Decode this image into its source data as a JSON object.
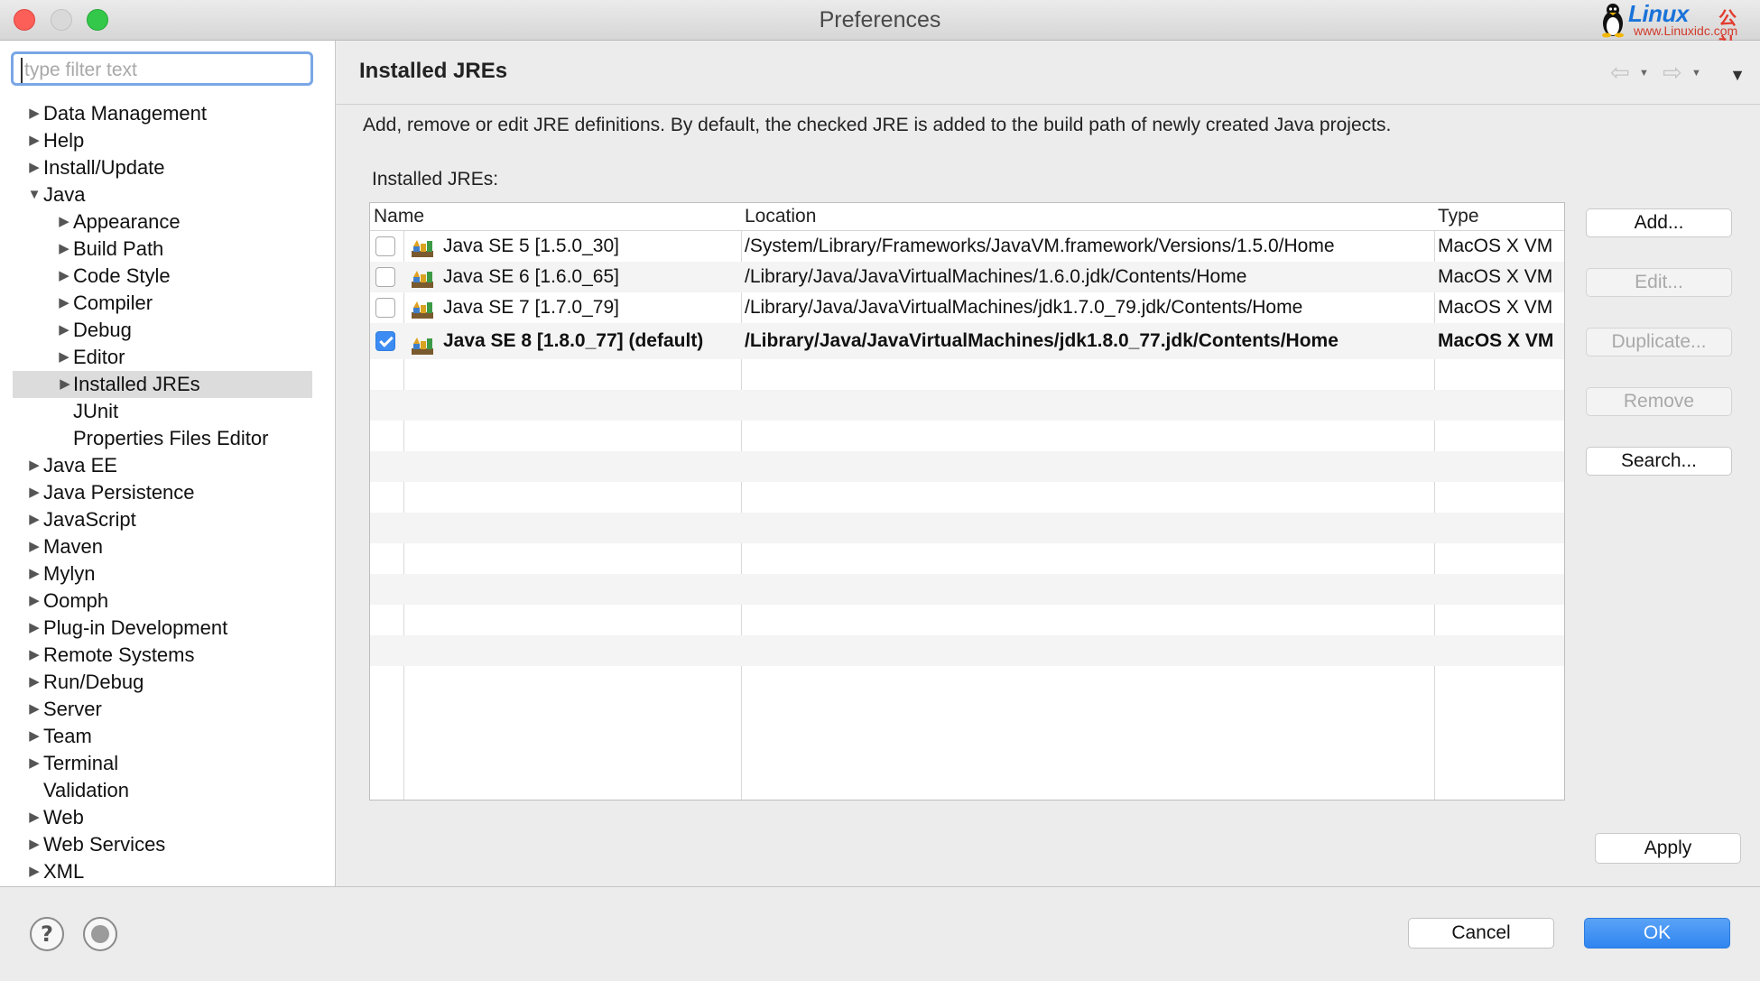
{
  "window": {
    "title": "Preferences",
    "watermark": {
      "brand": "Linux",
      "brand_cn": "公社",
      "url": "www.Linuxidc.com"
    }
  },
  "sidebar": {
    "filter_placeholder": "type filter text",
    "filter_value": "",
    "items": [
      {
        "label": "Data Management",
        "level": 0,
        "arrow": "right"
      },
      {
        "label": "Help",
        "level": 0,
        "arrow": "right"
      },
      {
        "label": "Install/Update",
        "level": 0,
        "arrow": "right"
      },
      {
        "label": "Java",
        "level": 0,
        "arrow": "down"
      },
      {
        "label": "Appearance",
        "level": 1,
        "arrow": "right"
      },
      {
        "label": "Build Path",
        "level": 1,
        "arrow": "right"
      },
      {
        "label": "Code Style",
        "level": 1,
        "arrow": "right"
      },
      {
        "label": "Compiler",
        "level": 1,
        "arrow": "right"
      },
      {
        "label": "Debug",
        "level": 1,
        "arrow": "right"
      },
      {
        "label": "Editor",
        "level": 1,
        "arrow": "right"
      },
      {
        "label": "Installed JREs",
        "level": 1,
        "arrow": "right",
        "selected": true
      },
      {
        "label": "JUnit",
        "level": 1,
        "arrow": "none"
      },
      {
        "label": "Properties Files Editor",
        "level": 1,
        "arrow": "none"
      },
      {
        "label": "Java EE",
        "level": 0,
        "arrow": "right"
      },
      {
        "label": "Java Persistence",
        "level": 0,
        "arrow": "right"
      },
      {
        "label": "JavaScript",
        "level": 0,
        "arrow": "right"
      },
      {
        "label": "Maven",
        "level": 0,
        "arrow": "right"
      },
      {
        "label": "Mylyn",
        "level": 0,
        "arrow": "right"
      },
      {
        "label": "Oomph",
        "level": 0,
        "arrow": "right"
      },
      {
        "label": "Plug-in Development",
        "level": 0,
        "arrow": "right"
      },
      {
        "label": "Remote Systems",
        "level": 0,
        "arrow": "right"
      },
      {
        "label": "Run/Debug",
        "level": 0,
        "arrow": "right"
      },
      {
        "label": "Server",
        "level": 0,
        "arrow": "right"
      },
      {
        "label": "Team",
        "level": 0,
        "arrow": "right"
      },
      {
        "label": "Terminal",
        "level": 0,
        "arrow": "right"
      },
      {
        "label": "Validation",
        "level": 0,
        "arrow": "none"
      },
      {
        "label": "Web",
        "level": 0,
        "arrow": "right"
      },
      {
        "label": "Web Services",
        "level": 0,
        "arrow": "right"
      },
      {
        "label": "XML",
        "level": 0,
        "arrow": "right"
      }
    ]
  },
  "main": {
    "title": "Installed JREs",
    "description": "Add, remove or edit JRE definitions. By default, the checked JRE is added to the build path of newly created Java projects.",
    "section_label": "Installed JREs:",
    "table": {
      "columns": [
        "Name",
        "Location",
        "Type"
      ],
      "rows": [
        {
          "checked": false,
          "bold": false,
          "name": "Java SE 5 [1.5.0_30]",
          "location": "/System/Library/Frameworks/JavaVM.framework/Versions/1.5.0/Home",
          "type": "MacOS X VM"
        },
        {
          "checked": false,
          "bold": false,
          "name": "Java SE 6 [1.6.0_65]",
          "location": "/Library/Java/JavaVirtualMachines/1.6.0.jdk/Contents/Home",
          "type": "MacOS X VM"
        },
        {
          "checked": false,
          "bold": false,
          "name": "Java SE 7 [1.7.0_79]",
          "location": "/Library/Java/JavaVirtualMachines/jdk1.7.0_79.jdk/Contents/Home",
          "type": "MacOS X VM"
        },
        {
          "checked": true,
          "bold": true,
          "name": "Java SE 8 [1.8.0_77] (default)",
          "location": "/Library/Java/JavaVirtualMachines/jdk1.8.0_77.jdk/Contents/Home",
          "type": "MacOS X VM"
        }
      ]
    },
    "buttons": {
      "add": "Add...",
      "edit": "Edit...",
      "duplicate": "Duplicate...",
      "remove": "Remove",
      "search": "Search..."
    },
    "apply": "Apply"
  },
  "footer": {
    "cancel": "Cancel",
    "ok": "OK"
  },
  "colors": {
    "accent": "#3d8cf3",
    "selection": "#dcdcdc"
  }
}
